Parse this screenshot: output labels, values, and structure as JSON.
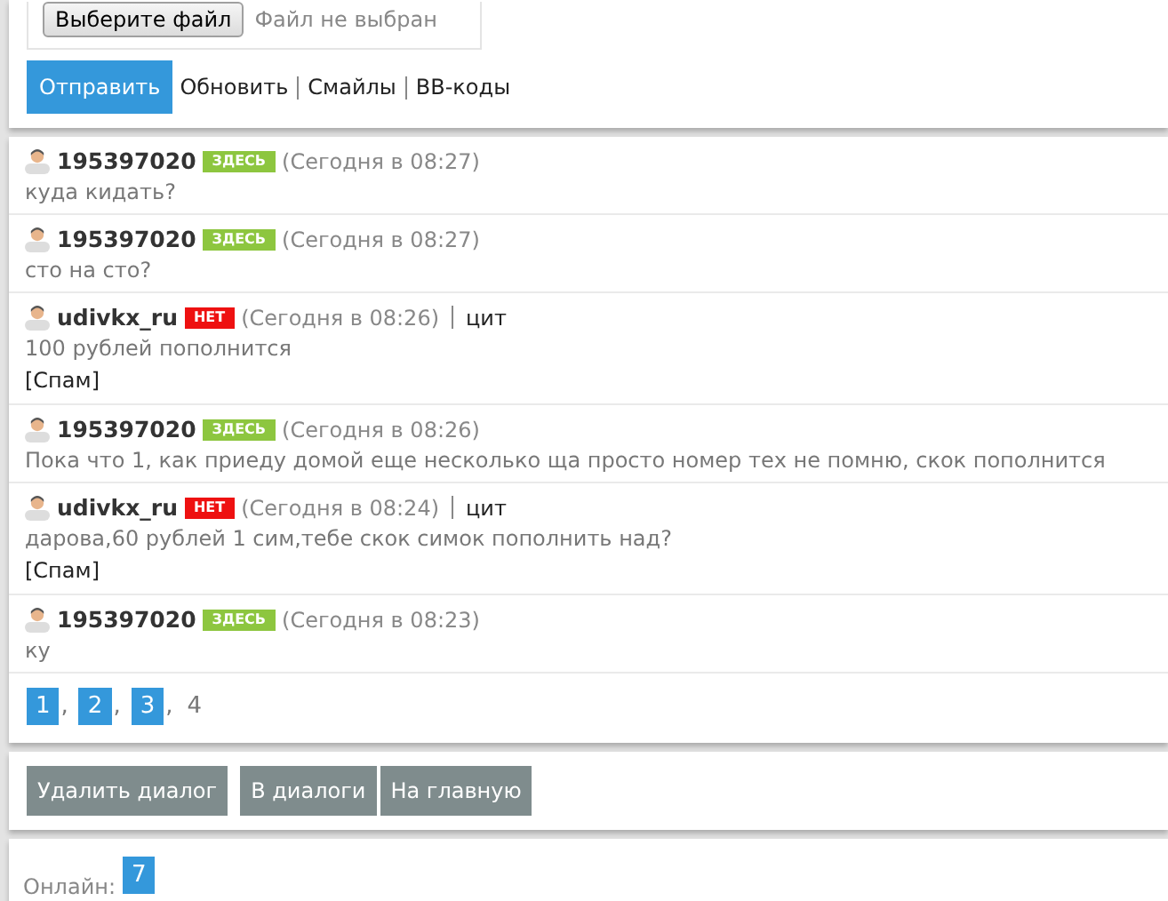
{
  "upload": {
    "button": "Выберите файл",
    "status": "Файл не выбран"
  },
  "actions": {
    "submit": "Отправить",
    "links": [
      "Обновить",
      "Смайлы",
      "BB-коды"
    ]
  },
  "messages": [
    {
      "author": "195397020",
      "online": true,
      "badge": "ЗДЕСЬ",
      "time": "(Сегодня в 08:27)",
      "text": "куда кидать?"
    },
    {
      "author": "195397020",
      "online": true,
      "badge": "ЗДЕСЬ",
      "time": "(Сегодня в 08:27)",
      "text": "сто на сто?"
    },
    {
      "author": "udivkx_ru",
      "online": false,
      "badge": "НЕТ",
      "time": "(Сегодня в 08:26)",
      "quote": "цит",
      "text": "100 рублей пополнится",
      "spam": "[Спам]"
    },
    {
      "author": "195397020",
      "online": true,
      "badge": "ЗДЕСЬ",
      "time": "(Сегодня в 08:26)",
      "text": "Пока что 1, как приеду домой еще несколько ща просто номер тех не помню, скок пополнится"
    },
    {
      "author": "udivkx_ru",
      "online": false,
      "badge": "НЕТ",
      "time": "(Сегодня в 08:24)",
      "quote": "цит",
      "text": "дарова,60 рублей 1 сим,тебе скок симок пополнить над?",
      "spam": "[Спам]"
    },
    {
      "author": "195397020",
      "online": true,
      "badge": "ЗДЕСЬ",
      "time": "(Сегодня в 08:23)",
      "text": "ку"
    }
  ],
  "page_separator": ",",
  "pages": [
    {
      "label": "1",
      "selected": false
    },
    {
      "label": "2",
      "selected": false
    },
    {
      "label": "3",
      "selected": false
    },
    {
      "label": "4",
      "selected": true
    }
  ],
  "buttons": [
    "Удалить диалог",
    "В диалоги",
    "На главную"
  ],
  "online": {
    "label": "Онлайн:",
    "count": "7"
  }
}
